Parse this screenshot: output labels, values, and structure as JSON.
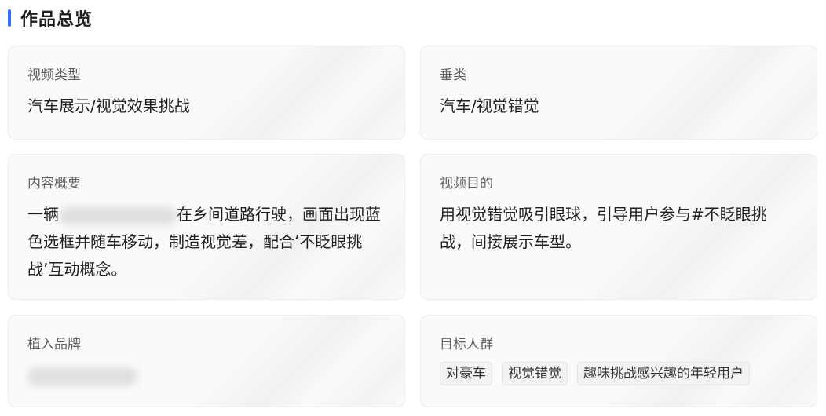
{
  "section_title": "作品总览",
  "cards": {
    "video_type": {
      "label": "视频类型",
      "value": "汽车展示/视觉效果挑战"
    },
    "vertical": {
      "label": "垂类",
      "value": "汽车/视觉错觉"
    },
    "summary": {
      "label": "内容概要",
      "text_before": "一辆",
      "text_after": "在乡间道路行驶，画面出现蓝色选框并随车移动，制造视觉差，配合‘不眨眼挑战’互动概念。"
    },
    "purpose": {
      "label": "视频目的",
      "value": "用视觉错觉吸引眼球，引导用户参与#不眨眼挑战，间接展示车型。"
    },
    "brand": {
      "label": "植入品牌"
    },
    "audience": {
      "label": "目标人群",
      "tags": [
        "对豪车",
        "视觉错觉",
        "趣味挑战感兴趣的年轻用户"
      ]
    }
  }
}
